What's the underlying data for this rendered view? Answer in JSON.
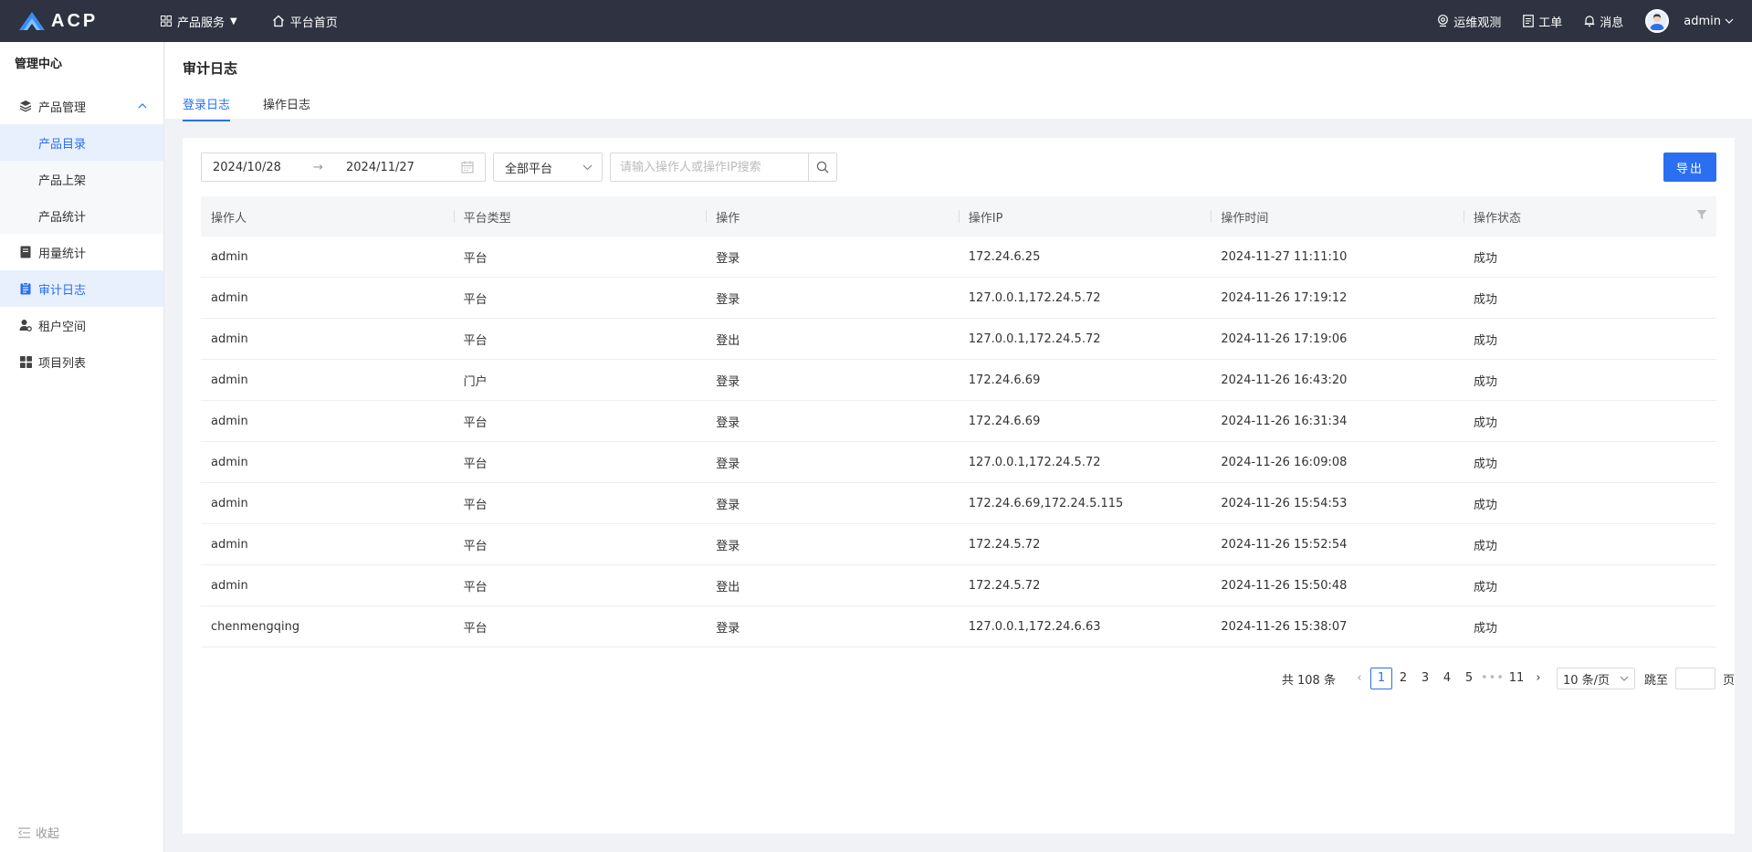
{
  "topbar": {
    "logo_text": "ACP",
    "nav": [
      {
        "label": "产品服务",
        "icon": "grid-icon",
        "has_dropdown": true
      },
      {
        "label": "平台首页",
        "icon": "home-icon"
      }
    ],
    "right": [
      {
        "label": "运维观测",
        "icon": "monitor-icon"
      },
      {
        "label": "工单",
        "icon": "ticket-icon"
      },
      {
        "label": "消息",
        "icon": "bell-icon"
      }
    ],
    "user": "admin"
  },
  "sidebar": {
    "title": "管理中心",
    "product_mgmt": "产品管理",
    "sub_items": [
      "产品目录",
      "产品上架",
      "产品统计"
    ],
    "items": [
      "用量统计",
      "审计日志",
      "租户空间",
      "项目列表"
    ],
    "collapse": "收起"
  },
  "header": {
    "title": "审计日志",
    "tabs": [
      "登录日志",
      "操作日志"
    ]
  },
  "filters": {
    "date_start": "2024/10/28",
    "date_sep": "→",
    "date_end": "2024/11/27",
    "platform": "全部平台",
    "search_placeholder": "请输入操作人或操作IP搜索",
    "export": "导出"
  },
  "table": {
    "columns": [
      "操作人",
      "平台类型",
      "操作",
      "操作IP",
      "操作时间",
      "操作状态"
    ],
    "rows": [
      [
        "admin",
        "平台",
        "登录",
        "172.24.6.25",
        "2024-11-27 11:11:10",
        "成功"
      ],
      [
        "admin",
        "平台",
        "登录",
        "127.0.0.1,172.24.5.72",
        "2024-11-26 17:19:12",
        "成功"
      ],
      [
        "admin",
        "平台",
        "登出",
        "127.0.0.1,172.24.5.72",
        "2024-11-26 17:19:06",
        "成功"
      ],
      [
        "admin",
        "门户",
        "登录",
        "172.24.6.69",
        "2024-11-26 16:43:20",
        "成功"
      ],
      [
        "admin",
        "平台",
        "登录",
        "172.24.6.69",
        "2024-11-26 16:31:34",
        "成功"
      ],
      [
        "admin",
        "平台",
        "登录",
        "127.0.0.1,172.24.5.72",
        "2024-11-26 16:09:08",
        "成功"
      ],
      [
        "admin",
        "平台",
        "登录",
        "172.24.6.69,172.24.5.115",
        "2024-11-26 15:54:53",
        "成功"
      ],
      [
        "admin",
        "平台",
        "登录",
        "172.24.5.72",
        "2024-11-26 15:52:54",
        "成功"
      ],
      [
        "admin",
        "平台",
        "登出",
        "172.24.5.72",
        "2024-11-26 15:50:48",
        "成功"
      ],
      [
        "chenmengqing",
        "平台",
        "登录",
        "127.0.0.1,172.24.6.63",
        "2024-11-26 15:38:07",
        "成功"
      ]
    ]
  },
  "pagination": {
    "total": "共 108 条",
    "prev": "‹",
    "pages": [
      "1",
      "2",
      "3",
      "4",
      "5"
    ],
    "dots": "•••",
    "last": "11",
    "next": "›",
    "page_size": "10 条/页",
    "jump_prefix": "跳至",
    "jump_suffix": "页"
  },
  "colors": {
    "accent": "#2a6ff0",
    "topbar": "#2f3240"
  }
}
